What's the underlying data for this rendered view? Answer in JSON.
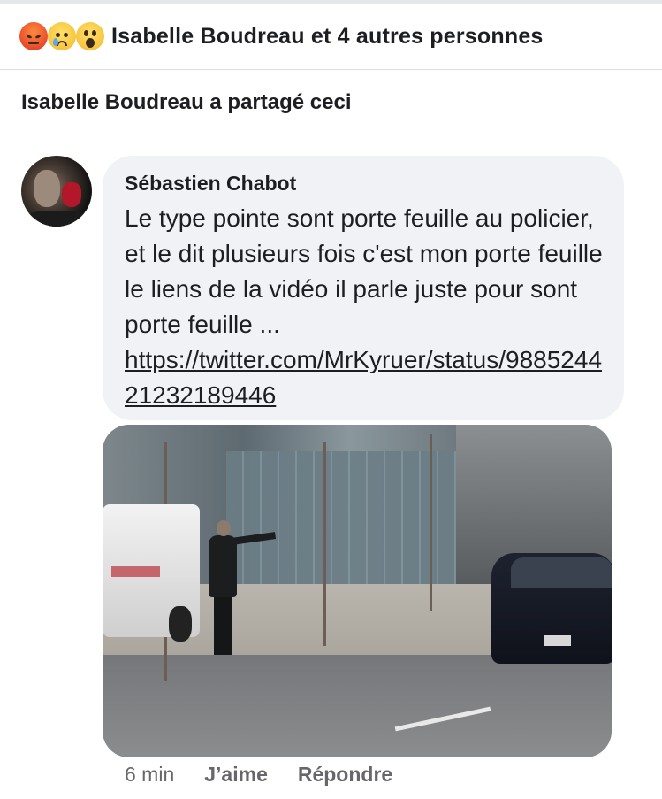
{
  "reactions": {
    "icons": [
      "angry-reaction",
      "sad-reaction",
      "wow-reaction"
    ],
    "summary": "Isabelle Boudreau et 4 autres personnes"
  },
  "share": {
    "text": "Isabelle Boudreau a partagé ceci"
  },
  "comment": {
    "author": "Sébastien Chabot",
    "body": "Le type pointe sont porte feuille au policier, et le dit plusieurs fois c'est mon porte feuille le liens de la vidéo il parle juste pour sont porte feuille ...",
    "link": "https://twitter.com/MrKyruer/status/988524421232189446"
  },
  "footer": {
    "time": "6 min",
    "like_label": "J’aime",
    "reply_label": "Répondre"
  },
  "colors": {
    "background": "#ffffff",
    "bubble": "#f0f2f5",
    "secondary_text": "#65676b",
    "primary_text": "#1c1e21"
  }
}
